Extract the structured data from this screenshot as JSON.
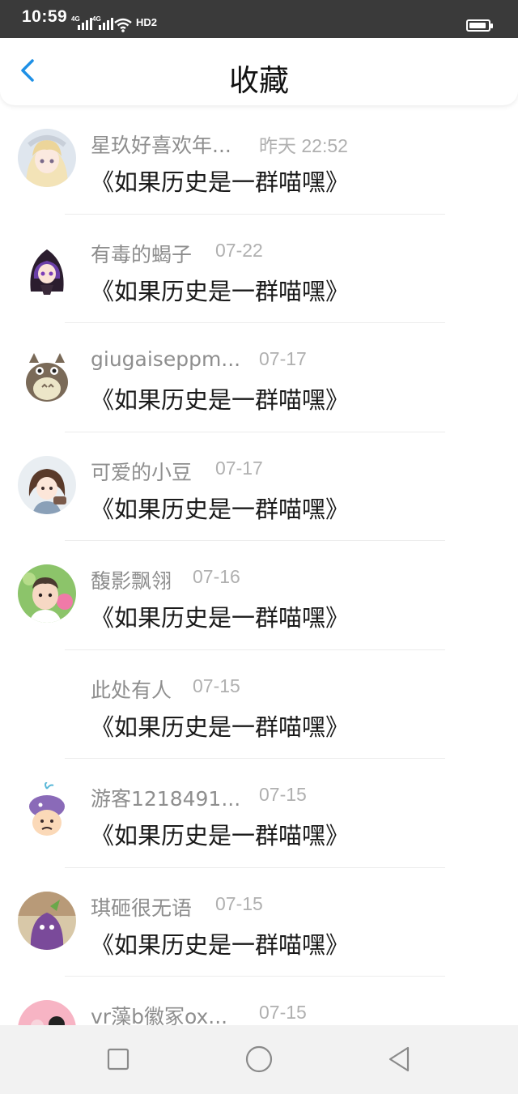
{
  "status_bar": {
    "time": "10:59",
    "network_1": "4G",
    "network_2": "4G",
    "hd": "HD2"
  },
  "header": {
    "title": "收藏",
    "back_icon": "chevron-left-icon"
  },
  "favorites": [
    {
      "user": "星玖好喜欢年...",
      "time": "昨天 22:52",
      "title": "《如果历史是一群喵嘿》",
      "avatar": "anime-blonde-girl"
    },
    {
      "user": "有毒的蝎子",
      "time": "07-22",
      "title": "《如果历史是一群喵嘿》",
      "avatar": "hooded-purple-girl"
    },
    {
      "user": "giugaiseppm...",
      "time": "07-17",
      "title": "《如果历史是一群喵嘿》",
      "avatar": "totoro"
    },
    {
      "user": "可爱的小豆",
      "time": "07-17",
      "title": "《如果历史是一群喵嘿》",
      "avatar": "cartoon-girl"
    },
    {
      "user": "馥影飘翎",
      "time": "07-16",
      "title": "《如果历史是一群喵嘿》",
      "avatar": "baby-photo"
    },
    {
      "user": "此处有人",
      "time": "07-15",
      "title": "《如果历史是一群喵嘿》",
      "avatar": "none"
    },
    {
      "user": "游客1218491...",
      "time": "07-15",
      "title": "《如果历史是一群喵嘿》",
      "avatar": "whale-cartoon"
    },
    {
      "user": "琪砸很无语",
      "time": "07-15",
      "title": "《如果历史是一群喵嘿》",
      "avatar": "purple-food"
    },
    {
      "user": "vr藻b徽冢ox...",
      "time": "07-15",
      "title": "",
      "avatar": "pink-partial"
    }
  ],
  "nav_bar": {
    "recents_icon": "square-icon",
    "home_icon": "circle-icon",
    "back_icon": "triangle-back-icon"
  },
  "colors": {
    "accent": "#1e90e6",
    "status_bar": "#3a3a3a",
    "name_gray": "#8e8e8e",
    "time_gray": "#b0b0b0"
  }
}
